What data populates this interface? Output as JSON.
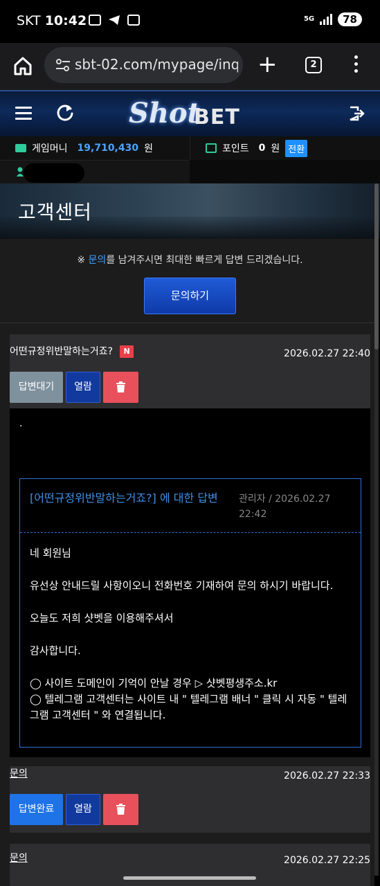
{
  "status_bar": {
    "carrier": "SKT",
    "time": "10:42",
    "network": "5G",
    "battery": "78"
  },
  "browser": {
    "url": "sbt-02.com/mypage/inq",
    "tab_count": "2"
  },
  "site": {
    "logo_script": "Shot",
    "logo_word": "BET"
  },
  "account": {
    "game_money_label": "게임머니",
    "game_money_value": "19,710,430",
    "game_money_unit": "원",
    "points_label": "포인트",
    "points_value": "0",
    "points_unit": "원",
    "convert_label": "전환"
  },
  "page": {
    "title": "고객센터",
    "notice_prefix": "※ ",
    "notice_link": "문의",
    "notice_suffix": "를 남겨주시면 최대한 빠르게 답변 드리겠습니다.",
    "inquiry_button": "문의하기"
  },
  "inquiries": [
    {
      "title": "어떤규정위반말하는거죠?",
      "badge": "N",
      "date": "2026.02.27 22:40",
      "status": "답변대기",
      "view_label": "열람",
      "body": ".",
      "answer": {
        "title": "[어떤규정위반말하는거죠?] 에 대한 답변",
        "meta": "관리자 / 2026.02.27 22:42",
        "lines": [
          "네 회원님",
          "유선상 안내드릴 사항이오니 전화번호 기재하여 문의 하시기 바랍니다.",
          "오늘도 저희 샷벳을 이용해주셔서",
          "감사합니다.",
          "◯ 사이트 도메인이 기억이 안날 경우 ▷ 샷벳평생주소.kr",
          "◯ 텔레그램 고객센터는 사이트 내 \" 텔레그램 배너 \" 클릭 시 자동 \" 텔레그램 고객센터 \" 와 연결됩니다."
        ]
      }
    },
    {
      "title": "문의",
      "date": "2026.02.27 22:33",
      "status": "답변완료",
      "view_label": "열람"
    },
    {
      "title": "문의",
      "date": "2026.02.27 22:25"
    }
  ],
  "colors": {
    "accent": "#1e90ff",
    "link": "#3fa0ff",
    "danger": "#e8505b",
    "waiting": "#7f919d",
    "answer_border": "#2f6fd6"
  }
}
